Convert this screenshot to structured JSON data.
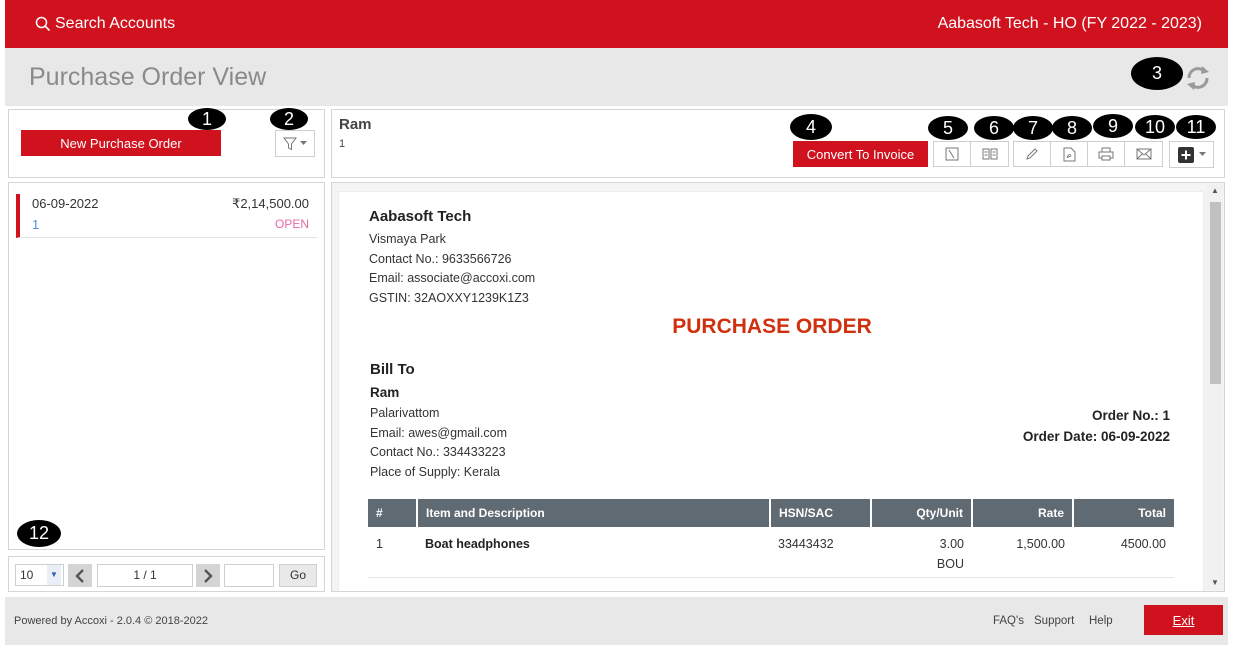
{
  "header": {
    "search_label": "Search Accounts",
    "company": "Aabasoft Tech - HO (FY 2022 - 2023)"
  },
  "page": {
    "title": "Purchase Order View"
  },
  "badges": [
    "1",
    "2",
    "3",
    "4",
    "5",
    "6",
    "7",
    "8",
    "9",
    "10",
    "11",
    "12"
  ],
  "left": {
    "new_button": "New Purchase Order",
    "list": [
      {
        "date": "06-09-2022",
        "amount": "₹2,14,500.00",
        "number": "1",
        "status": "OPEN"
      }
    ],
    "pager": {
      "page_size": "10",
      "page_info": "1 / 1",
      "go_label": "Go"
    }
  },
  "detail": {
    "vendor_name": "Ram",
    "order_number": "1",
    "convert_button": "Convert To Invoice"
  },
  "document": {
    "company_name": "Aabasoft Tech",
    "address": "Vismaya Park",
    "contact": "Contact No.: 9633566726",
    "email": "Email: associate@accoxi.com",
    "gstin": "GSTIN: 32AOXXY1239K1Z3",
    "title": "PURCHASE ORDER",
    "bill_to_heading": "Bill To",
    "customer_name": "Ram",
    "customer_address": "Palarivattom",
    "customer_email": "Email: awes@gmail.com",
    "customer_contact": "Contact No.: 334433223",
    "place_of_supply": "Place of Supply: Kerala",
    "order_no": "Order No.: 1",
    "order_date": "Order Date: 06-09-2022",
    "table": {
      "headers": [
        "#",
        "Item and Description",
        "HSN/SAC",
        "Qty/Unit",
        "Rate",
        "Total"
      ],
      "rows": [
        {
          "idx": "1",
          "item": "Boat headphones",
          "hsn": "33443432",
          "qty": "3.00",
          "unit": "BOU",
          "rate": "1,500.00",
          "total": "4500.00"
        }
      ]
    }
  },
  "footer": {
    "powered_by": "Powered by Accoxi - 2.0.4 © 2018-2022",
    "faq": "FAQ's",
    "support": "Support",
    "help": "Help",
    "exit": "Exit"
  },
  "colors": {
    "brand_red": "#d0121f",
    "title_red": "#d0300e",
    "status_open": "#e56aa6",
    "table_header": "#5f6a73"
  }
}
